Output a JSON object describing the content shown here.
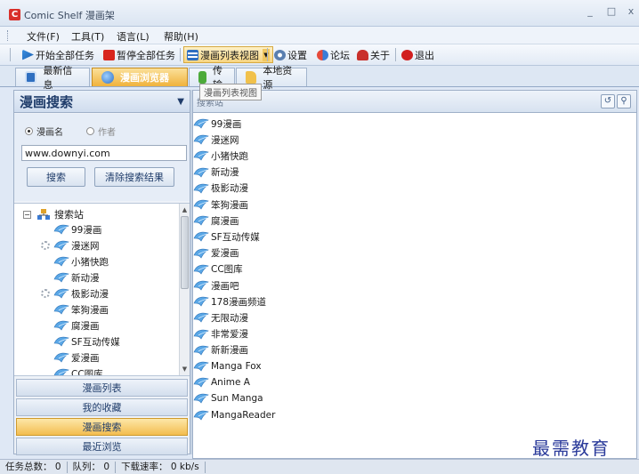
{
  "window": {
    "logo_letter": "C",
    "title": "Comic Shelf 漫画架",
    "minimize": "_",
    "maximize": "□",
    "close": "x"
  },
  "menu": {
    "items": [
      "文件(F)",
      "工具(T)",
      "语言(L)",
      "帮助(H)"
    ]
  },
  "toolbar": {
    "start_all": "开始全部任务",
    "pause_all": "暂停全部任务",
    "list_view": "漫画列表视图",
    "settings": "设置",
    "forum": "论坛",
    "about": "关于",
    "exit": "退出"
  },
  "tabs": [
    "最新信息",
    "漫画浏览器",
    "传输",
    "本地资源"
  ],
  "tooltip": "漫画列表视图",
  "search_panel": {
    "title": "漫画搜索",
    "radio_name": "漫画名",
    "radio_author": "作者",
    "input_value": "www.downyi.com",
    "search_button": "搜索",
    "clear_button": "清除搜索结果",
    "tree_root": "搜索站",
    "tree_items": [
      "99漫画",
      "漫迷网",
      "小猪快跑",
      "新动漫",
      "极影动漫",
      "笨狗漫画",
      "腐漫画",
      "SF互动传媒",
      "爱漫画",
      "CC图库"
    ]
  },
  "nav_buttons": [
    "漫画列表",
    "我的收藏",
    "漫画搜索",
    "最近浏览"
  ],
  "right_panel": {
    "header_label": "搜索站",
    "sites": [
      "99漫画",
      "漫迷网",
      "小猪快跑",
      "新动漫",
      "极影动漫",
      "笨狗漫画",
      "腐漫画",
      "SF互动传媒",
      "爱漫画",
      "CC图库",
      "漫画吧",
      "178漫画频道",
      "无限动漫",
      "非常爱漫",
      "新新漫画",
      "Manga Fox",
      "Anime A",
      "Sun Manga",
      "MangaReader"
    ]
  },
  "watermark": "最需教育",
  "status": {
    "total_label": "任务总数：",
    "total_value": "0",
    "queue_label": "队列：",
    "queue_value": "0",
    "speed_label": "下载速率：",
    "speed_value": "0 kb/s"
  },
  "colors": {
    "accent_orange": "#f0b23c",
    "title_blue": "#1f3c6a",
    "logo_red": "#d9302a",
    "watermark": "#2a3a9a"
  }
}
